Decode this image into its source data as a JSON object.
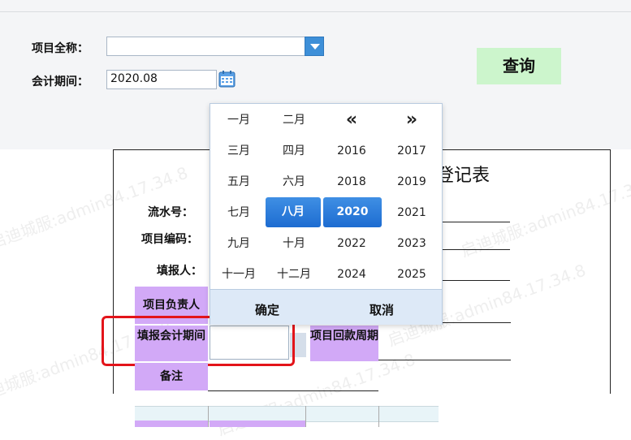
{
  "search": {
    "project_label": "项目全称：",
    "period_label": "会计期间：",
    "period_value": "2020.08",
    "query_label": "查询"
  },
  "form": {
    "title_partial": "登记表",
    "serial_label": "流水号：",
    "code_label": "项目编码：",
    "reporter_label": "填报人：",
    "manager_label": "项目负责人",
    "report_period_label": "填报会计期间",
    "payback_label": "项目回款周期",
    "remark_label": "备注"
  },
  "month_picker": {
    "months": [
      "一月",
      "二月",
      "三月",
      "四月",
      "五月",
      "六月",
      "七月",
      "八月",
      "九月",
      "十月",
      "十一月",
      "十二月"
    ],
    "selected_month": "八月",
    "prev_symbol": "«",
    "next_symbol": "»",
    "years": [
      "2016",
      "2017",
      "2018",
      "2019",
      "2020",
      "2021",
      "2022",
      "2023",
      "2024",
      "2025"
    ],
    "selected_year": "2020",
    "ok_label": "确定",
    "cancel_label": "取消"
  },
  "watermark": "启迪城服:admin84.17.34.8",
  "colors": {
    "query_bg": "#ccf5cc",
    "label_cell_bg": "#d2a9f7",
    "selected_bg": "#1d6cd1",
    "highlight_border": "#e3141a",
    "dropdown_btn": "#3d8fd8"
  }
}
